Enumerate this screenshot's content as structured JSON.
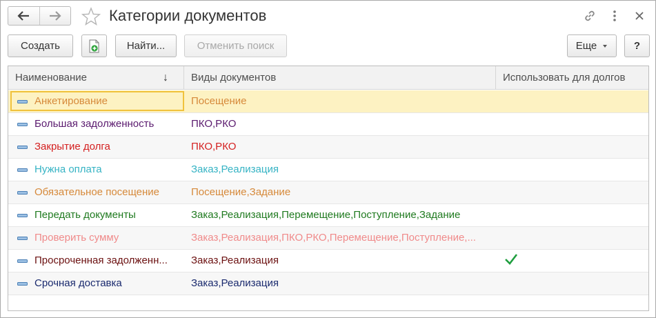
{
  "window": {
    "title": "Категории документов",
    "icons": [
      "back-arrow-icon",
      "forward-arrow-icon",
      "favorite-star-icon",
      "link-icon",
      "more-vertical-icon",
      "close-icon"
    ]
  },
  "toolbar": {
    "create_label": "Создать",
    "add_icon": "add-document-icon",
    "find_label": "Найти...",
    "cancel_search_label": "Отменить поиск",
    "more_label": "Еще",
    "help_label": "?"
  },
  "table": {
    "headers": {
      "name": "Наименование",
      "types": "Виды документов",
      "use_for_debts": "Использовать для долгов",
      "sort_indicator": "↓"
    },
    "rows": [
      {
        "name": "Анкетирование",
        "types": "Посещение",
        "use_for_debts": false,
        "color": "#d6893a",
        "selected": true
      },
      {
        "name": "Большая задолженность",
        "types": "ПКО,РКО",
        "use_for_debts": false,
        "color": "#5a1a6e",
        "selected": false
      },
      {
        "name": "Закрытие долга",
        "types": "ПКО,РКО",
        "use_for_debts": false,
        "color": "#d42020",
        "selected": false
      },
      {
        "name": "Нужна оплата",
        "types": "Заказ,Реализация",
        "use_for_debts": false,
        "color": "#35b3c4",
        "selected": false
      },
      {
        "name": "Обязательное посещение",
        "types": "Посещение,Задание",
        "use_for_debts": false,
        "color": "#d6893a",
        "selected": false
      },
      {
        "name": "Передать документы",
        "types": "Заказ,Реализация,Перемещение,Поступление,Задание",
        "use_for_debts": false,
        "color": "#1f7a1f",
        "selected": false
      },
      {
        "name": "Проверить сумму",
        "types": "Заказ,Реализация,ПКО,РКО,Перемещение,Поступление,...",
        "use_for_debts": false,
        "color": "#f08a8a",
        "selected": false
      },
      {
        "name": "Просроченная задолженн...",
        "types": "Заказ,Реализация",
        "use_for_debts": true,
        "color": "#6b1010",
        "selected": false
      },
      {
        "name": "Срочная доставка",
        "types": "Заказ,Реализация",
        "use_for_debts": false,
        "color": "#1a2a6e",
        "selected": false
      }
    ]
  },
  "colors": {
    "selection_bg": "#fdf2c2",
    "selection_border": "#f0c23c",
    "row_icon": "#4a7fb5",
    "check": "#1e9e3e"
  }
}
